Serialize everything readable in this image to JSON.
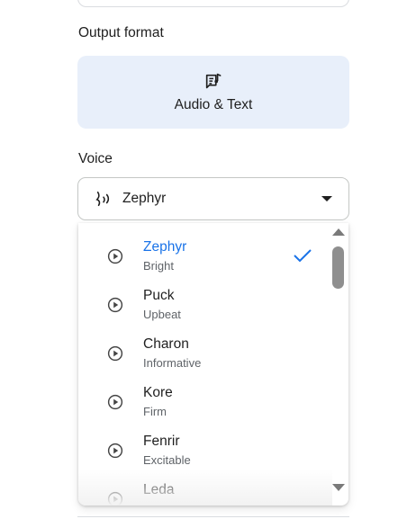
{
  "output_format": {
    "label": "Output format",
    "option_label": "Audio & Text",
    "icon": "music-note-text-icon"
  },
  "voice": {
    "label": "Voice",
    "selected": "Zephyr",
    "icon": "voice-wave-icon",
    "options": [
      {
        "name": "Zephyr",
        "description": "Bright"
      },
      {
        "name": "Puck",
        "description": "Upbeat"
      },
      {
        "name": "Charon",
        "description": "Informative"
      },
      {
        "name": "Kore",
        "description": "Firm"
      },
      {
        "name": "Fenrir",
        "description": "Excitable"
      },
      {
        "name": "Leda",
        "description": ""
      }
    ]
  },
  "colors": {
    "selected_accent": "#1a73e8",
    "card_bg": "#e8effa"
  }
}
